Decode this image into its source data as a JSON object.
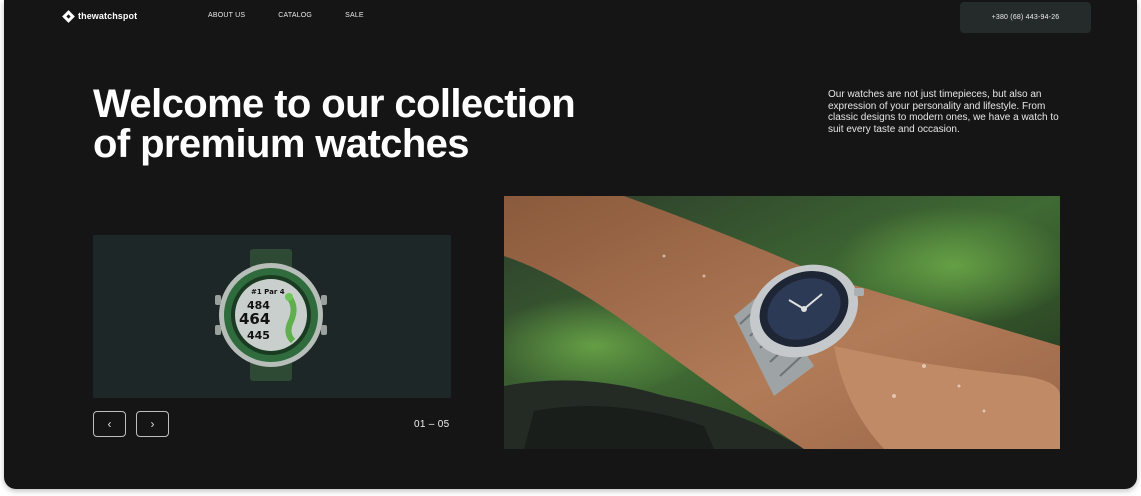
{
  "header": {
    "logo_text": "thewatchspot",
    "nav": [
      {
        "label": "ABOUT US"
      },
      {
        "label": "CATALOG"
      },
      {
        "label": "SALE"
      }
    ],
    "phone": "+380 (68) 443-94-26"
  },
  "hero": {
    "title_line1": "Welcome to our collection",
    "title_line2": "of premium watches",
    "description": "Our watches are not just timepieces, but also an expression of your personality and lifestyle. From classic designs to modern ones, we have a watch to suit every taste and occasion."
  },
  "carousel": {
    "watch_screen": {
      "hole": "#1 Par 4",
      "line1": "484",
      "line2": "464",
      "line3": "445"
    },
    "prev_icon": "chevron-left-icon",
    "next_icon": "chevron-right-icon",
    "counter": "01 – 05"
  },
  "colors": {
    "background": "#151515",
    "card": "#1e2727",
    "phone_button": "#252a2a",
    "text": "#ffffff"
  }
}
